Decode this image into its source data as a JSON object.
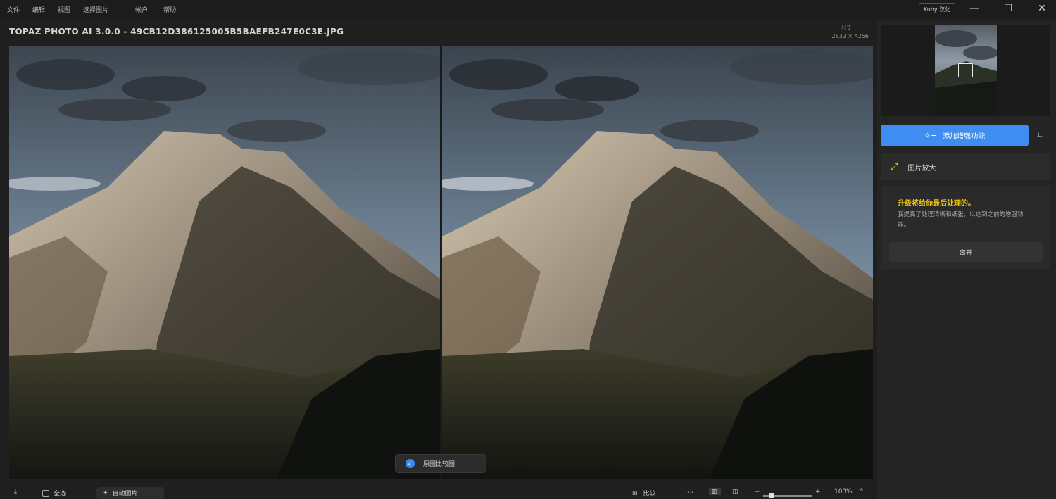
{
  "menu": {
    "items": [
      "文件",
      "编辑",
      "视图",
      "选择图片",
      "帐户",
      "帮助"
    ]
  },
  "window": {
    "badge": "Kuhy 汉化",
    "minimize": "—",
    "maximize": "☐",
    "close": "✕"
  },
  "title": "TOPAZ PHOTO AI 3.0.0 - 49CB12D386125005B5BAEFB247E0C3E.JPG",
  "image_info": {
    "dims_label": "尺寸",
    "dims": "2832 × 4256"
  },
  "preview_toggle": {
    "label": "原图比较图"
  },
  "panel": {
    "add_enhancement": "添加增强功能",
    "upscale": "图片放大",
    "upgrade_title": "升级将给你最后处理的。",
    "upgrade_desc": "我提高了处理清晰和纸张，以达到之前的增强功能。",
    "upgrade_button": "离开"
  },
  "bottom": {
    "select_all": "全选",
    "auto_pilot": "自动图片",
    "compare": "比较",
    "zoom": "103%"
  },
  "colors": {
    "accent": "#3f8df0",
    "warning": "#f1c40f"
  },
  "icons": {
    "crop": "crop-icon",
    "upscale": "expand-arrows-icon",
    "check": "check-icon",
    "add": "sparkle-plus-icon"
  }
}
